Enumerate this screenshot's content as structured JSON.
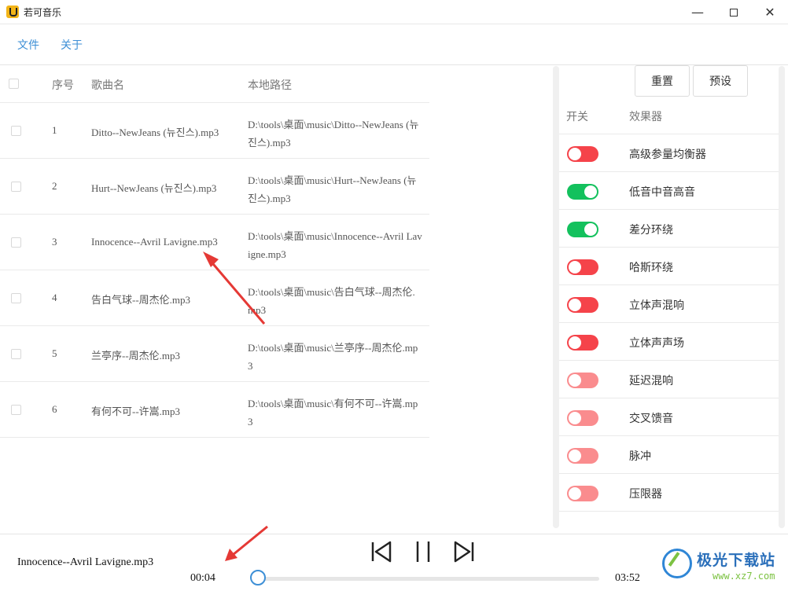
{
  "window": {
    "title": "若可音乐",
    "minimize": "—",
    "close": "✕"
  },
  "menu": {
    "file": "文件",
    "about": "关于"
  },
  "song_table": {
    "headers": {
      "index": "序号",
      "name": "歌曲名",
      "path": "本地路径"
    },
    "rows": [
      {
        "index": "1",
        "name": "Ditto--NewJeans (뉴진스).mp3",
        "path": "D:\\tools\\桌面\\music\\Ditto--NewJeans (뉴진스).mp3"
      },
      {
        "index": "2",
        "name": "Hurt--NewJeans (뉴진스).mp3",
        "path": "D:\\tools\\桌面\\music\\Hurt--NewJeans (뉴진스).mp3"
      },
      {
        "index": "3",
        "name": "Innocence--Avril Lavigne.mp3",
        "path": "D:\\tools\\桌面\\music\\Innocence--Avril Lavigne.mp3"
      },
      {
        "index": "4",
        "name": "告白气球--周杰伦.mp3",
        "path": "D:\\tools\\桌面\\music\\告白气球--周杰伦.mp3"
      },
      {
        "index": "5",
        "name": "兰亭序--周杰伦.mp3",
        "path": "D:\\tools\\桌面\\music\\兰亭序--周杰伦.mp3"
      },
      {
        "index": "6",
        "name": "有何不可--许嵩.mp3",
        "path": "D:\\tools\\桌面\\music\\有何不可--许嵩.mp3"
      }
    ]
  },
  "effects": {
    "reset_label": "重置",
    "preset_label": "预设",
    "headers": {
      "switch": "开关",
      "effect": "效果器"
    },
    "colors": {
      "on": "#13c15d",
      "off": "#f5434a",
      "off_faded": "#fa8c8e"
    },
    "items": [
      {
        "name": "高级参量均衡器",
        "state": "off"
      },
      {
        "name": "低音中音高音",
        "state": "on"
      },
      {
        "name": "差分环绕",
        "state": "on"
      },
      {
        "name": "哈斯环绕",
        "state": "off"
      },
      {
        "name": "立体声混响",
        "state": "off"
      },
      {
        "name": "立体声声场",
        "state": "off"
      },
      {
        "name": "延迟混响",
        "state": "off_faded"
      },
      {
        "name": "交叉馈音",
        "state": "off_faded"
      },
      {
        "name": "脉冲",
        "state": "off_faded"
      },
      {
        "name": "压限器",
        "state": "off_faded"
      }
    ]
  },
  "player": {
    "now_playing": "Innocence--Avril Lavigne.mp3",
    "current_time": "00:04",
    "total_time": "03:52",
    "progress_fraction": 0.017
  },
  "watermark": {
    "text": "极光下载站",
    "url": "www.xz7.com"
  }
}
